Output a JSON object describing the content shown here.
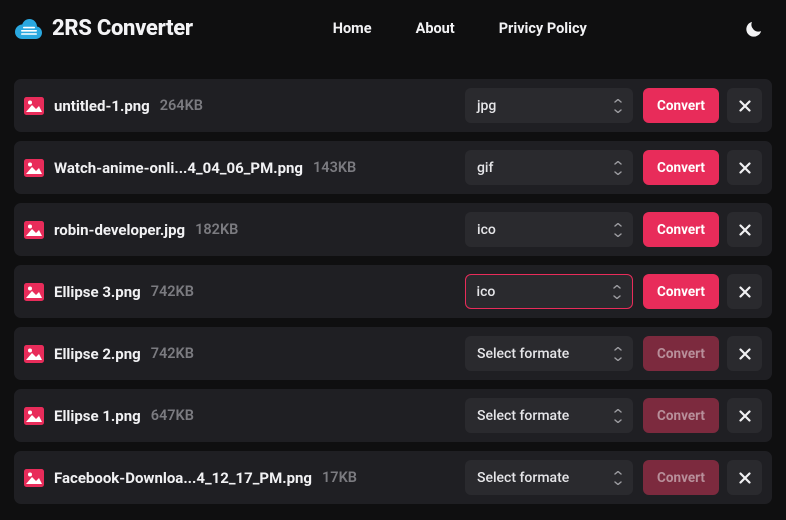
{
  "app": {
    "title": "2RS Converter"
  },
  "nav": {
    "home": "Home",
    "about": "About",
    "privacy": "Privicy Policy"
  },
  "ui": {
    "convert_label": "Convert",
    "select_placeholder": "Select formate"
  },
  "colors": {
    "accent": "#e82c5a",
    "bg": "#0f0f10",
    "row": "#1f1f23",
    "control": "#2a2a2e"
  },
  "files": [
    {
      "name": "untitled-1.png",
      "size": "264KB",
      "format": "jpg",
      "has_format": true,
      "active_select": false,
      "convert_enabled": true
    },
    {
      "name": "Watch-anime-onli...4_04_06_PM.png",
      "size": "143KB",
      "format": "gif",
      "has_format": true,
      "active_select": false,
      "convert_enabled": true
    },
    {
      "name": "robin-developer.jpg",
      "size": "182KB",
      "format": "ico",
      "has_format": true,
      "active_select": false,
      "convert_enabled": true
    },
    {
      "name": "Ellipse 3.png",
      "size": "742KB",
      "format": "ico",
      "has_format": true,
      "active_select": true,
      "convert_enabled": true
    },
    {
      "name": "Ellipse 2.png",
      "size": "742KB",
      "format": "",
      "has_format": false,
      "active_select": false,
      "convert_enabled": false
    },
    {
      "name": "Ellipse 1.png",
      "size": "647KB",
      "format": "",
      "has_format": false,
      "active_select": false,
      "convert_enabled": false
    },
    {
      "name": "Facebook-Downloa...4_12_17_PM.png",
      "size": "17KB",
      "format": "",
      "has_format": false,
      "active_select": false,
      "convert_enabled": false
    }
  ]
}
